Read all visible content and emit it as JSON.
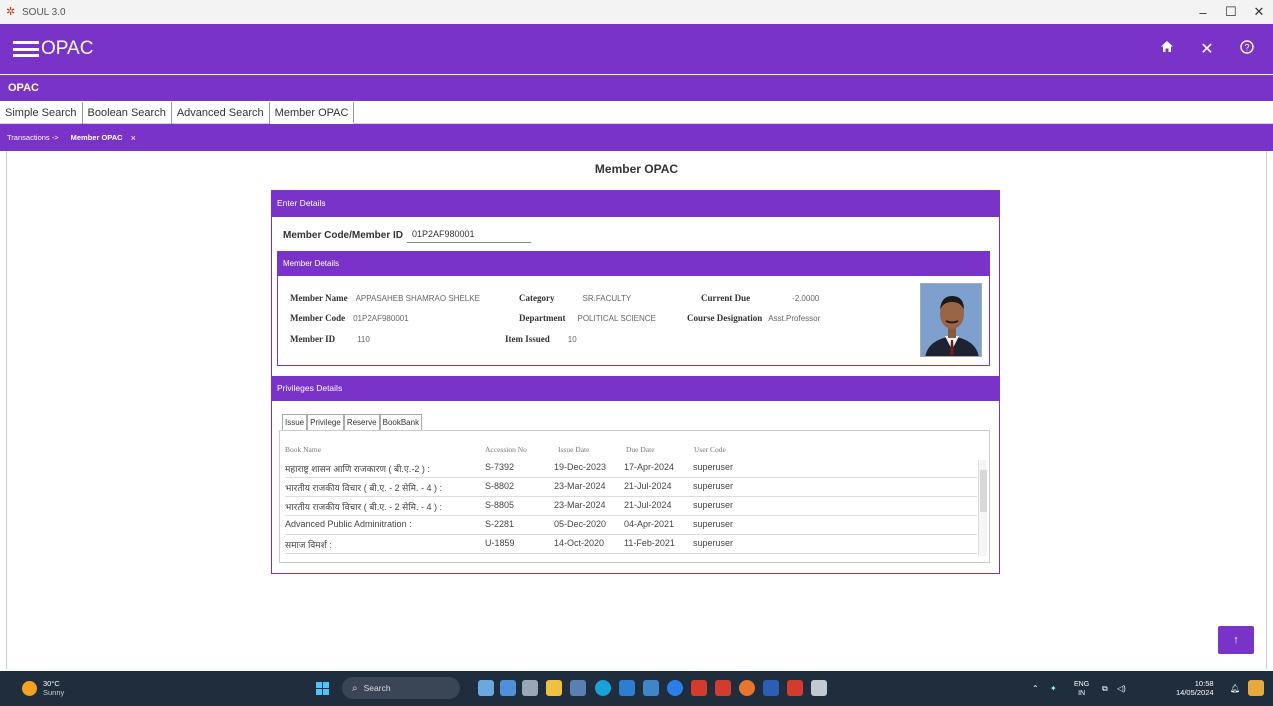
{
  "window": {
    "title": "SOUL 3.0",
    "controls": [
      "–",
      "☐",
      "✕"
    ]
  },
  "header": {
    "app_name": "OPAC",
    "icons": [
      "home-icon",
      "close-icon",
      "help-icon"
    ]
  },
  "subheader": {
    "label": "OPAC"
  },
  "search_tabs": [
    {
      "label": "Simple Search"
    },
    {
      "label": "Boolean Search"
    },
    {
      "label": "Advanced Search"
    },
    {
      "label": "Member OPAC"
    }
  ],
  "breadcrumb": {
    "parent": "Transactions ->",
    "current": "Member OPAC",
    "close": "×"
  },
  "page": {
    "title": "Member OPAC"
  },
  "enter_details": {
    "heading": "Enter Details",
    "member_label": "Member Code/Member ID",
    "member_value": "01P2AF980001"
  },
  "member_details": {
    "heading": "Member Details",
    "fields": {
      "member_name": {
        "label": "Member Name",
        "value": "APPASAHEB SHAMRAO SHELKE"
      },
      "member_code": {
        "label": "Member Code",
        "value": "01P2AF980001"
      },
      "member_id": {
        "label": "Member ID",
        "value": "110"
      },
      "category": {
        "label": "Category",
        "value": "SR.FACULTY"
      },
      "department": {
        "label": "Department",
        "value": "POLITICAL SCIENCE"
      },
      "item_issued": {
        "label": "Item Issued",
        "value": "10"
      },
      "current_due": {
        "label": "Current Due",
        "value": "-2.0000"
      },
      "course_designation": {
        "label": "Course Designation",
        "value": "Asst.Professor"
      }
    }
  },
  "privileges": {
    "heading": "Privileges Details",
    "tabs": [
      {
        "label": "Issue"
      },
      {
        "label": "Privilege"
      },
      {
        "label": "Reserve"
      },
      {
        "label": "BookBank"
      }
    ],
    "columns": [
      "Book Name",
      "Accession No",
      "Issue Date",
      "Due Date",
      "User Code"
    ],
    "rows": [
      {
        "book": "महाराष्ट्र शासन आणि राजकारण ( बी.ए.-2 ) :",
        "acc": "S-7392",
        "issue": "19-Dec-2023",
        "due": "17-Apr-2024",
        "user": "superuser"
      },
      {
        "book": "भारतीय राजकीय विचार ( बी.ए. - 2 सेमि. - 4 ) :",
        "acc": "S-8802",
        "issue": "23-Mar-2024",
        "due": "21-Jul-2024",
        "user": "superuser"
      },
      {
        "book": "भारतीय राजकीय विचार ( बी.ए. - 2 सेमि. - 4 ) :",
        "acc": "S-8805",
        "issue": "23-Mar-2024",
        "due": "21-Jul-2024",
        "user": "superuser"
      },
      {
        "book": "Advanced Public Adminitration :",
        "acc": "S-2281",
        "issue": "05-Dec-2020",
        "due": "04-Apr-2021",
        "user": "superuser"
      },
      {
        "book": "समाज विमर्श :",
        "acc": "U-1859",
        "issue": "14-Oct-2020",
        "due": "11-Feb-2021",
        "user": "superuser"
      }
    ]
  },
  "scroll_top": {
    "label": "↑"
  },
  "taskbar": {
    "weather_temp": "30°C",
    "weather_cond": "Sunny",
    "search_placeholder": "Search",
    "lang_top": "ENG",
    "lang_bottom": "IN",
    "time": "10:58",
    "date": "14/05/2024"
  },
  "colors": {
    "accent": "#7a33c9",
    "taskbar": "#1f2d3d"
  }
}
